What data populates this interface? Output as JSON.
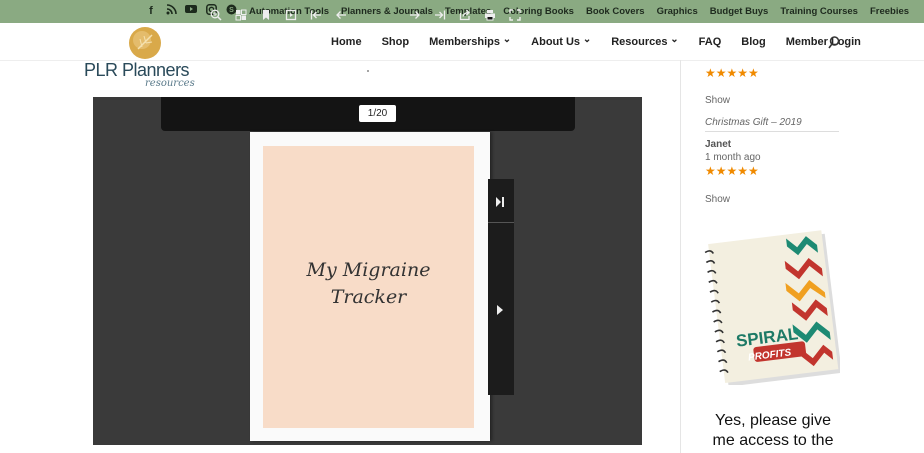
{
  "social": {
    "icons": [
      "facebook-icon",
      "rss-icon",
      "youtube-icon",
      "instagram-icon",
      "skype-icon"
    ]
  },
  "top_nav": [
    "Automation Tools",
    "Planners & Journals",
    "Templates",
    "Coloring Books",
    "Book Covers",
    "Graphics",
    "Budget Buys",
    "Training Courses",
    "Freebies"
  ],
  "logo": {
    "text": "PLR Planners",
    "subtext": "resources"
  },
  "main_nav": {
    "items": [
      {
        "label": "Home",
        "dropdown": false
      },
      {
        "label": "Shop",
        "dropdown": false
      },
      {
        "label": "Memberships",
        "dropdown": true
      },
      {
        "label": "About Us",
        "dropdown": true
      },
      {
        "label": "Resources",
        "dropdown": true
      },
      {
        "label": "FAQ",
        "dropdown": false
      },
      {
        "label": "Blog",
        "dropdown": false
      },
      {
        "label": "Member Login",
        "dropdown": false
      }
    ]
  },
  "viewer": {
    "page_indicator": "1/20",
    "cover_title_line1": "My Migraine",
    "cover_title_line2": "Tracker"
  },
  "sidebar": {
    "review1": {
      "link": "Show",
      "product": "Christmas Gift – 2019"
    },
    "review2": {
      "author": "Janet",
      "time": "1 month ago",
      "link": "Show"
    },
    "book_text1": "SPIRAL",
    "book_text2": "PROFITS",
    "promo_line1": "Yes, please give",
    "promo_line2": "me access to the"
  },
  "colors": {
    "topbar": "#8aaa82",
    "star": "#f08a00",
    "viewer_bg": "#3a3a3a"
  }
}
